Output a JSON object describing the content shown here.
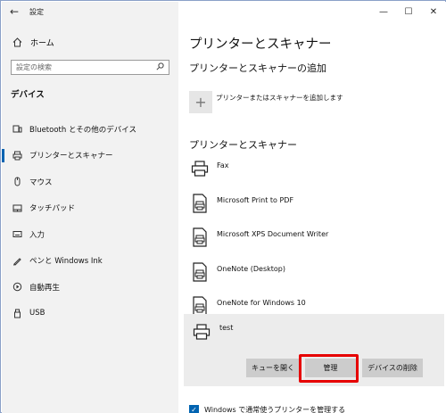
{
  "window": {
    "app_title": "設定",
    "controls": {
      "minimize": "—",
      "maximize": "☐",
      "close": "✕"
    }
  },
  "sidebar": {
    "back_glyph": "←",
    "home_label": "ホーム",
    "search_placeholder": "設定の検索",
    "section_title": "デバイス",
    "items": [
      {
        "label": "Bluetooth とその他のデバイス",
        "icon": "bluetooth-devices-icon",
        "selected": false
      },
      {
        "label": "プリンターとスキャナー",
        "icon": "printer-icon",
        "selected": true
      },
      {
        "label": "マウス",
        "icon": "mouse-icon",
        "selected": false
      },
      {
        "label": "タッチパッド",
        "icon": "touchpad-icon",
        "selected": false
      },
      {
        "label": "入力",
        "icon": "keyboard-icon",
        "selected": false
      },
      {
        "label": "ペンと Windows Ink",
        "icon": "pen-icon",
        "selected": false
      },
      {
        "label": "自動再生",
        "icon": "autoplay-icon",
        "selected": false
      },
      {
        "label": "USB",
        "icon": "usb-icon",
        "selected": false
      }
    ]
  },
  "main": {
    "page_title": "プリンターとスキャナー",
    "add_section_title": "プリンターとスキャナーの追加",
    "add_button_glyph": "+",
    "add_label": "プリンターまたはスキャナーを追加します",
    "printers_title": "プリンターとスキャナー",
    "printers": [
      {
        "name": "Fax",
        "icon": "fax-icon"
      },
      {
        "name": "Microsoft Print to PDF",
        "icon": "printer-doc-icon"
      },
      {
        "name": "Microsoft XPS Document Writer",
        "icon": "printer-doc-icon"
      },
      {
        "name": "OneNote (Desktop)",
        "icon": "printer-doc-icon"
      },
      {
        "name": "OneNote for Windows 10",
        "icon": "printer-doc-icon"
      }
    ],
    "selected_printer": {
      "name": "test",
      "buttons": {
        "open_queue": "キューを開く",
        "manage": "管理",
        "remove": "デバイスの削除"
      }
    },
    "default_printer_checkbox": {
      "label": "Windows で通常使うプリンターを管理する",
      "checked": true
    },
    "accent_color": "#0063b1",
    "highlight_color": "#e60000"
  }
}
